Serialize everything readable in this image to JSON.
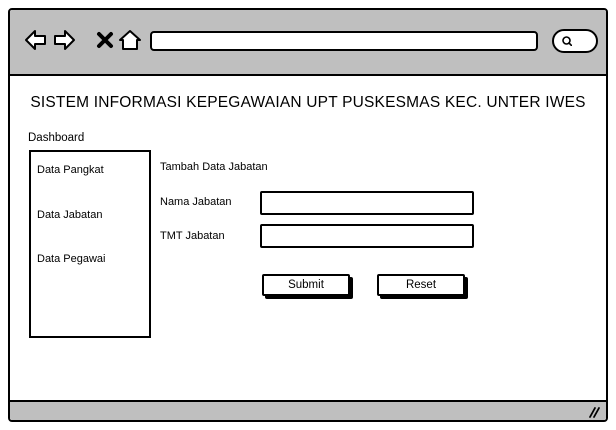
{
  "browser": {
    "icons": {
      "back": "arrow-left-icon",
      "forward": "arrow-right-icon",
      "stop": "close-icon",
      "home": "home-icon",
      "search": "search-icon",
      "resize": "resize-grip-icon"
    },
    "address_value": ""
  },
  "header": {
    "title": "SISTEM INFORMASI KEPEGAWAIAN UPT PUSKESMAS KEC. UNTER IWES"
  },
  "breadcrumb": {
    "label": "Dashboard"
  },
  "sidebar": {
    "items": [
      {
        "label": "Data Pangkat"
      },
      {
        "label": "Data Jabatan"
      },
      {
        "label": "Data Pegawai"
      }
    ]
  },
  "form": {
    "title": "Tambah Data Jabatan",
    "fields": [
      {
        "label": "Nama Jabatan",
        "value": ""
      },
      {
        "label": "TMT Jabatan",
        "value": ""
      }
    ],
    "submit_label": "Submit",
    "reset_label": "Reset"
  },
  "colors": {
    "chrome": "#bfbfbf",
    "border": "#000000",
    "background": "#ffffff"
  }
}
